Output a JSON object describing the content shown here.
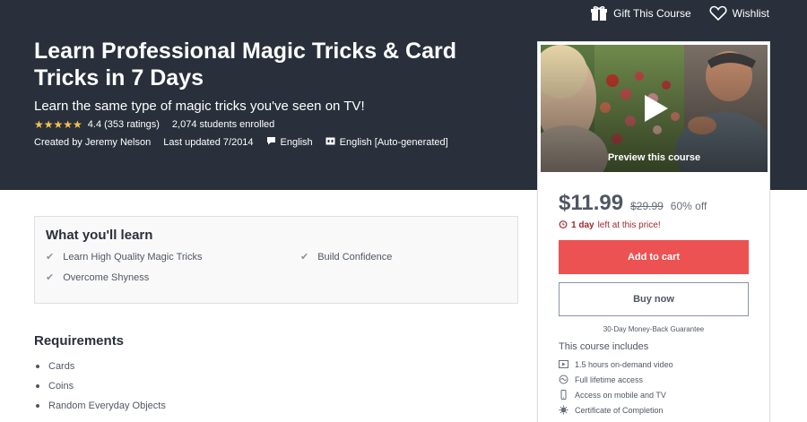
{
  "topbar": {
    "gift_label": "Gift This Course",
    "wishlist_label": "Wishlist"
  },
  "course": {
    "title": "Learn Professional Magic Tricks & Card Tricks in 7 Days",
    "subtitle": "Learn the same type of magic tricks you've seen on TV!",
    "stars": "★★★★★",
    "rating": "4.4 (353 ratings)",
    "enrolled": "2,074 students enrolled",
    "created_by": "Created by Jeremy Nelson",
    "last_updated": "Last updated 7/2014",
    "language": "English",
    "captions": "English [Auto-generated]"
  },
  "sidebar": {
    "preview_label": "Preview this course",
    "price": "$11.99",
    "original_price": "$29.99",
    "discount": "60% off",
    "timer_bold": "1 day",
    "timer_rest": "left at this price!",
    "add_to_cart": "Add to cart",
    "buy_now": "Buy now",
    "guarantee": "30-Day Money-Back Guarantee",
    "includes_heading": "This course includes",
    "includes": [
      {
        "icon": "video-icon",
        "label": "1.5 hours on-demand video"
      },
      {
        "icon": "infinity-icon",
        "label": "Full lifetime access"
      },
      {
        "icon": "mobile-icon",
        "label": "Access on mobile and TV"
      },
      {
        "icon": "certificate-icon",
        "label": "Certificate of Completion"
      }
    ]
  },
  "learn": {
    "heading": "What you'll learn",
    "items": [
      "Learn High Quality Magic Tricks",
      "Build Confidence",
      "Overcome Shyness"
    ]
  },
  "requirements": {
    "heading": "Requirements",
    "items": [
      "Cards",
      "Coins",
      "Random Everyday Objects"
    ]
  },
  "colors": {
    "hero_bg": "#29303b",
    "accent_red": "#ec5252",
    "star_gold": "#f4c150",
    "timer_red": "#a1292f"
  }
}
